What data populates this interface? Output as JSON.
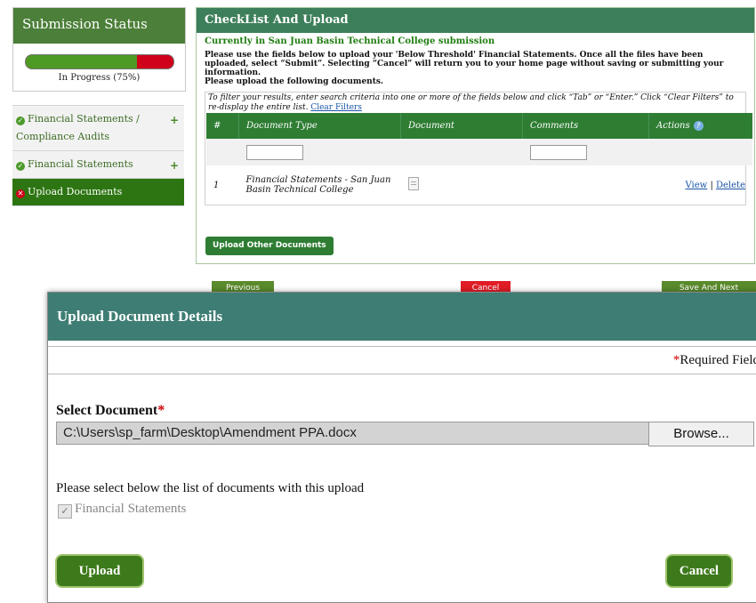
{
  "status": {
    "title": "Submission Status",
    "progress_percent": 75,
    "progress_label": "In Progress (75%)",
    "colors": {
      "done": "#4d9a25",
      "remaining": "#d0021b"
    }
  },
  "nav": {
    "items": [
      {
        "label": "Financial Statements / Compliance Audits",
        "icon": "check-icon",
        "expand": "+"
      },
      {
        "label": "Financial Statements",
        "icon": "check-icon",
        "expand": "+"
      },
      {
        "label": "Upload Documents",
        "icon": "error-icon"
      }
    ]
  },
  "checklist": {
    "title": "CheckList And Upload",
    "subtitle": "Currently in San Juan Basin Technical College submission",
    "instructions": "Please use the fields below to upload your 'Below Threshold' Financial Statements. Once all the files have been uploaded, select “Submit”. Selecting “Cancel” will return you to your home page without saving or submitting your information.",
    "instructions2": "Please upload the following documents.",
    "filter_hint": "To filter your results, enter search criteria into one or more of the fields below and click “Tab” or “Enter.” Click “Clear Filters” to re-display the entire list.",
    "clear_filters": "Clear Filters",
    "columns": [
      "#",
      "Document Type",
      "Document",
      "Comments",
      "Actions"
    ],
    "rows": [
      {
        "num": "1",
        "doc_type": "Financial Statements - San Juan Basin Technical College",
        "view": "View",
        "sep": "|",
        "delete": "Delete"
      }
    ],
    "upload_other": "Upload Other Documents"
  },
  "behind_buttons": {
    "previous": "Previous",
    "cancel": "Cancel",
    "save_next": "Save And Next"
  },
  "modal": {
    "title": "Upload Document Details",
    "required_note": "Required Field",
    "required_star": "*",
    "select_label": "Select Document",
    "file_path": "C:\\Users\\sp_farm\\Desktop\\Amendment PPA.docx",
    "browse": "Browse...",
    "list_label": "Please select below the list of documents with this upload",
    "doc_option": "Financial Statements",
    "upload": "Upload",
    "cancel": "Cancel"
  }
}
